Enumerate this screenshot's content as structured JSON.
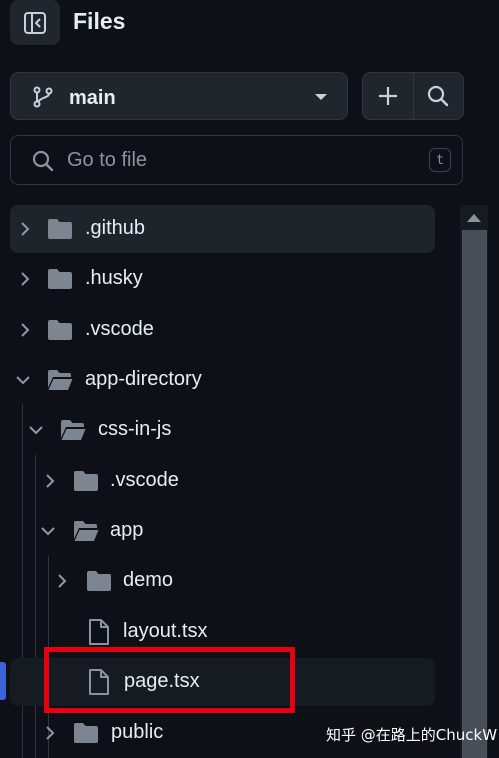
{
  "header": {
    "title": "Files"
  },
  "branch": {
    "name": "main"
  },
  "search": {
    "placeholder": "Go to file",
    "value": "",
    "shortcut": "t"
  },
  "tree": {
    "items": [
      {
        "label": ".github",
        "kind": "folder",
        "expanded": false
      },
      {
        "label": ".husky",
        "kind": "folder",
        "expanded": false
      },
      {
        "label": ".vscode",
        "kind": "folder",
        "expanded": false
      },
      {
        "label": "app-directory",
        "kind": "folder",
        "expanded": true
      },
      {
        "label": "css-in-js",
        "kind": "folder",
        "expanded": true
      },
      {
        "label": ".vscode",
        "kind": "folder",
        "expanded": false
      },
      {
        "label": "app",
        "kind": "folder",
        "expanded": true
      },
      {
        "label": "demo",
        "kind": "folder",
        "expanded": false
      },
      {
        "label": "layout.tsx",
        "kind": "file"
      },
      {
        "label": "page.tsx",
        "kind": "file",
        "selected": true
      },
      {
        "label": "public",
        "kind": "folder",
        "expanded": false
      }
    ]
  },
  "icons": {
    "sidebar_toggle": "sidebar-collapse-icon",
    "branch": "git-branch-icon",
    "dropdown": "triangle-down-icon",
    "add": "plus-icon",
    "search": "search-icon"
  },
  "watermark": {
    "text": "知乎 @在路上的ChuckW"
  },
  "colors": {
    "background": "#0d1117",
    "control": "#21262d",
    "border": "#30363d",
    "text": "#e6edf3",
    "muted": "#8b949e",
    "highlight": "#e60012",
    "accent": "#3d63d8"
  }
}
